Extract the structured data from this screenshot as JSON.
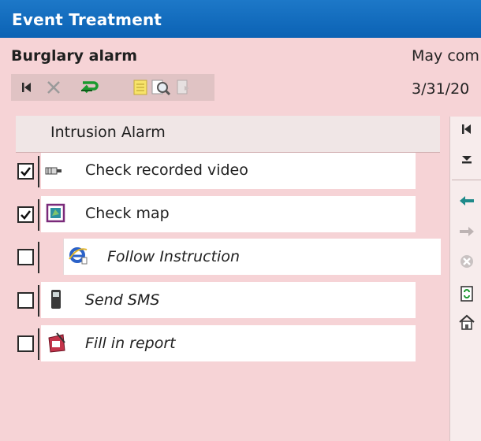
{
  "window": {
    "title": "Event Treatment"
  },
  "event": {
    "name": "Burglary alarm",
    "right_text_1": "May com",
    "right_text_2": "3/31/20"
  },
  "toolbar": {
    "icons": [
      "first-icon",
      "delete-icon",
      "return-icon",
      "notes-icon",
      "search-icon",
      "page-icon"
    ]
  },
  "panel": {
    "title": "Intrusion Alarm",
    "tasks": [
      {
        "label": "Check recorded video",
        "checked": true,
        "icon": "video-icon",
        "italic": false
      },
      {
        "label": "Check map",
        "checked": true,
        "icon": "map-icon",
        "italic": false
      },
      {
        "label": "Follow Instruction",
        "checked": false,
        "icon": "internet-icon",
        "italic": true
      },
      {
        "label": "Send SMS",
        "checked": false,
        "icon": "phone-icon",
        "italic": true
      },
      {
        "label": "Fill in report",
        "checked": false,
        "icon": "report-icon",
        "italic": true
      }
    ]
  },
  "sidebar": {
    "icons": [
      "first-icon",
      "collapse-icon",
      "back-icon",
      "forward-icon",
      "cancel-icon",
      "refresh-icon",
      "home-icon"
    ]
  },
  "colors": {
    "titlebar": "#0b62b4",
    "background": "#f6d3d6",
    "accent_green": "#1b9a2e"
  }
}
